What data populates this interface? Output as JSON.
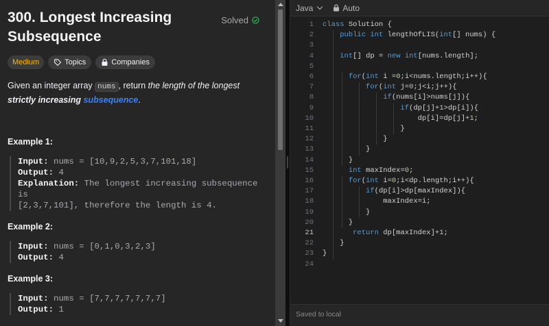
{
  "problem": {
    "title": "300. Longest Increasing Subsequence",
    "status": "Solved",
    "tags": [
      "Medium",
      "Topics",
      "Companies"
    ],
    "description": {
      "pre": "Given an integer array ",
      "code": "nums",
      "mid": ", return ",
      "em": "the length of the longest ",
      "strong": "strictly increasing",
      "space": " ",
      "link": "subsequence",
      "post": "."
    },
    "examples": [
      {
        "title": "Example 1:",
        "input_label": "Input:",
        "input": " nums = [10,9,2,5,3,7,101,18]",
        "output_label": "Output:",
        "output": " 4",
        "expl_label": "Explanation:",
        "expl1": " The longest increasing subsequence is",
        "expl2": "[2,3,7,101], therefore the length is 4."
      },
      {
        "title": "Example 2:",
        "input_label": "Input:",
        "input": " nums = [0,1,0,3,2,3]",
        "output_label": "Output:",
        "output": " 4"
      },
      {
        "title": "Example 3:",
        "input_label": "Input:",
        "input": " nums = [7,7,7,7,7,7,7]",
        "output_label": "Output:",
        "output": " 1"
      }
    ]
  },
  "editor": {
    "language": "Java",
    "mode": "Auto",
    "footer": "Saved to local",
    "active_line": 21,
    "lines": [
      "class Solution {",
      "    public int lengthOfLIS(int[] nums) {",
      "",
      "    int[] dp = new int[nums.length];",
      "",
      "      for(int i =0;i<nums.length;i++){",
      "          for(int j=0;j<i;j++){",
      "              if(nums[i]>nums[j]){",
      "                  if(dp[j]+1>dp[i]){",
      "                      dp[i]=dp[j]+1;",
      "                  }",
      "              }",
      "          }",
      "      }",
      "      int maxIndex=0;",
      "      for(int i=0;i<dp.length;i++){",
      "          if(dp[i]>dp[maxIndex]){",
      "              maxIndex=i;",
      "          }",
      "      }",
      "       return dp[maxIndex]+1;",
      "    }",
      "}",
      ""
    ]
  }
}
